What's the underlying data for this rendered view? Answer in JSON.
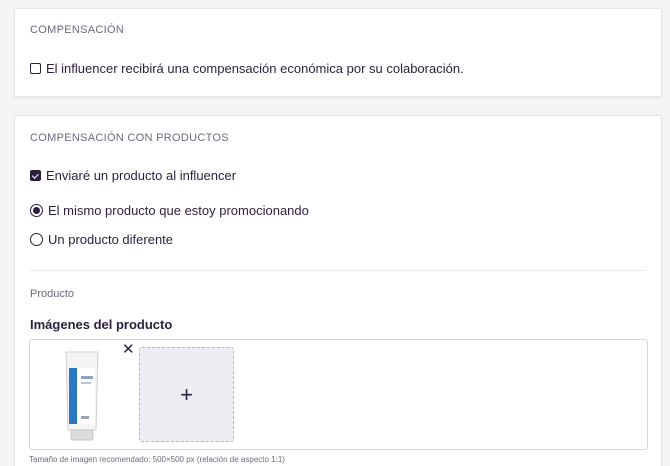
{
  "compensation": {
    "title": "COMPENSACIÓN",
    "checkbox_label": "El influencer recibirá una compensación económica por su colaboración.",
    "checked": false
  },
  "product_compensation": {
    "title": "COMPENSACIÓN CON PRODUCTOS",
    "send_product_label": "Enviaré un producto al influencer",
    "send_product_checked": true,
    "options": [
      {
        "label": "El mismo producto que estoy promocionando",
        "selected": true
      },
      {
        "label": "Un producto diferente",
        "selected": false
      }
    ],
    "product_label": "Producto",
    "images_heading": "Imágenes del producto",
    "add_icon": "plus-icon",
    "remove_icon": "close-icon",
    "size_hint": "Tamaño de imagen recomendado: 500×500 px (relación de aspecto 1:1)"
  },
  "colors": {
    "primary": "#2b1f3d",
    "muted": "#6f6880",
    "background": "#f5f4f7",
    "add_slot_bg": "#efedf4"
  }
}
